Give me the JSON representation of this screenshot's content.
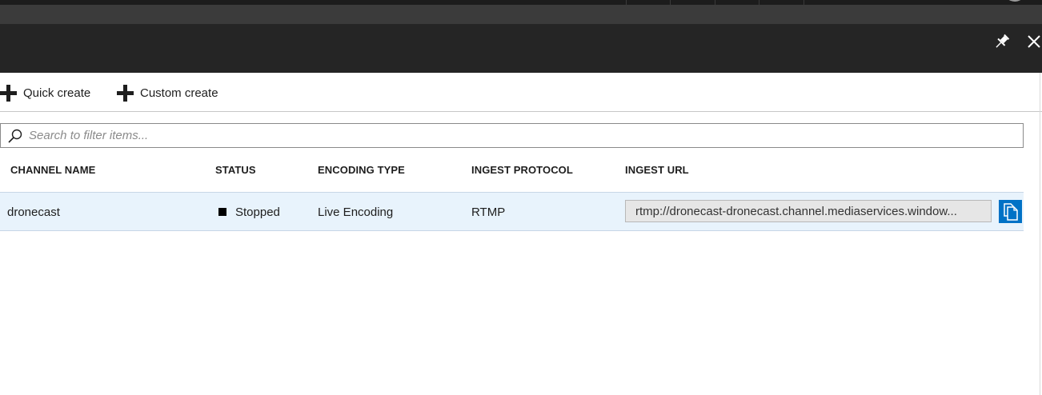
{
  "toolbar": {
    "quick_create": "Quick create",
    "custom_create": "Custom create"
  },
  "search": {
    "placeholder": "Search to filter items..."
  },
  "table": {
    "columns": [
      "CHANNEL NAME",
      "STATUS",
      "ENCODING TYPE",
      "INGEST PROTOCOL",
      "INGEST URL"
    ],
    "rows": [
      {
        "channel_name": "dronecast",
        "status": "Stopped",
        "encoding_type": "Live Encoding",
        "ingest_protocol": "RTMP",
        "ingest_url": "rtmp://dronecast-dronecast.channel.mediaservices.window..."
      }
    ]
  },
  "icons": {
    "pin": "pin-icon",
    "close": "close-icon",
    "add": "plus-icon",
    "search": "search-icon",
    "copy": "copy-icon",
    "status": "stopped-square-icon"
  },
  "colors": {
    "titlebar": "#252525",
    "row_selected": "#e8f3fc",
    "accent": "#0072c6"
  }
}
